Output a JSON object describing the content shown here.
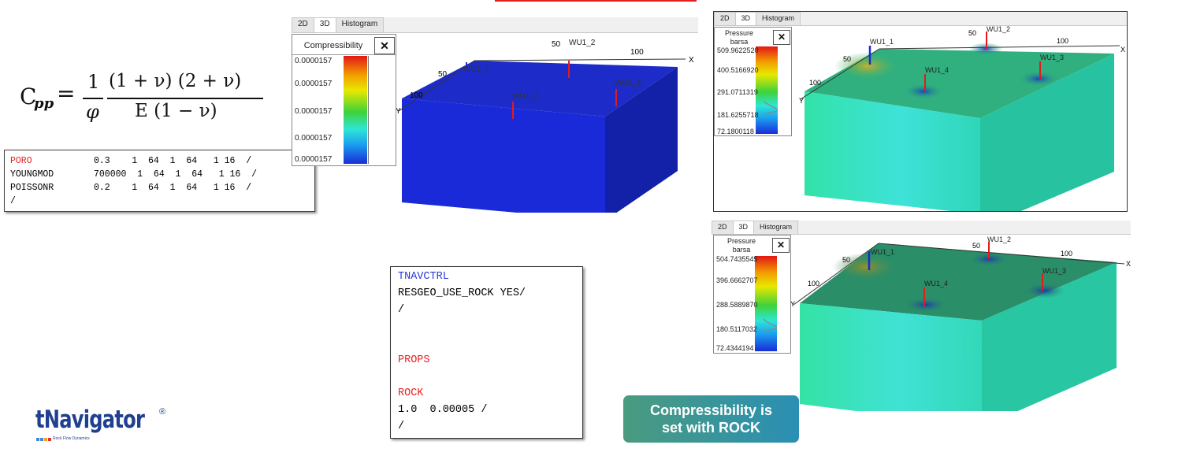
{
  "formula": {
    "lhs": "C",
    "lhs_sub": "pp",
    "equals": "=",
    "frac1_num": "1",
    "frac1_den": "φ",
    "frac2_num": "(1 + ν) (2 + ν)",
    "frac2_den": "E (1 − ν)"
  },
  "grid_props": {
    "lines": [
      {
        "keyword": "PORO",
        "values": "0.3    1  64  1  64   1 16  /"
      },
      {
        "keyword": "YOUNGMOD",
        "values": "700000  1  64  1  64   1 16  /"
      },
      {
        "keyword": "POISSONR",
        "values": "0.2    1  64  1  64   1 16  /"
      },
      {
        "keyword": "",
        "values": "/"
      }
    ]
  },
  "viewer1": {
    "tabs": [
      "2D",
      "3D",
      "Histogram"
    ],
    "active_tab": "3D",
    "legend_title": "Compressibility",
    "legend_values": [
      "0.0000157",
      "0.0000157",
      "0.0000157",
      "0.0000157",
      "0.0000157"
    ],
    "close_label": "✕",
    "axis_labels": {
      "x": "X",
      "y": "Y",
      "x_tick_50": "50",
      "x_tick_100": "100",
      "y_tick_50": "50",
      "y_tick_100": "100"
    },
    "wells": [
      "WU1_1",
      "WU1_2",
      "WU1_3",
      "WU1_4"
    ],
    "colors": {
      "top": "#1d2cc8",
      "front": "#1a2ad8",
      "side": "#1320a8",
      "well": "#e11c1c"
    }
  },
  "viewer2": {
    "tabs": [
      "2D",
      "3D",
      "Histogram"
    ],
    "active_tab": "3D",
    "legend_title": "Pressure barsa",
    "legend_values": [
      "509.9622520",
      "400.5166920",
      "291.0711319",
      "181.6255718",
      "72.1800118"
    ],
    "close_label": "✕",
    "axis_labels": {
      "x": "X",
      "y": "Y",
      "x_tick_50": "50",
      "x_tick_100": "100",
      "y_tick_50": "50",
      "y_tick_100": "100"
    },
    "wells": [
      "WU1_1",
      "WU1_2",
      "WU1_3",
      "WU1_4"
    ]
  },
  "viewer3": {
    "tabs": [
      "2D",
      "3D",
      "Histogram"
    ],
    "active_tab": "3D",
    "legend_title": "Pressure barsa",
    "legend_values": [
      "504.7435545",
      "396.6662707",
      "288.5889870",
      "180.5117032",
      "72.4344194"
    ],
    "close_label": "✕",
    "axis_labels": {
      "x": "X",
      "y": "Y",
      "x_tick_50": "50",
      "x_tick_100": "100",
      "y_tick_50": "50",
      "y_tick_100": "100"
    },
    "wells": [
      "WU1_1",
      "WU1_2",
      "WU1_3",
      "WU1_4"
    ]
  },
  "rock_code": {
    "lines": [
      {
        "text": "TNAVCTRL",
        "color": "blue"
      },
      {
        "text": "RESGEO_USE_ROCK YES/",
        "color": "black"
      },
      {
        "text": "/",
        "color": "black"
      },
      {
        "text": "",
        "color": "black"
      },
      {
        "text": "",
        "color": "black"
      },
      {
        "text": "PROPS",
        "color": "red"
      },
      {
        "text": "",
        "color": "black"
      },
      {
        "text": "ROCK",
        "color": "red"
      },
      {
        "text": "1.0  0.00005 /",
        "color": "black"
      },
      {
        "text": "/",
        "color": "black"
      }
    ]
  },
  "badge": {
    "line1": "Compressibility is",
    "line2": "set with ROCK"
  },
  "logo": {
    "text": "tNavigator",
    "registered": "®",
    "tagline": "Rock Flow Dynamics"
  }
}
